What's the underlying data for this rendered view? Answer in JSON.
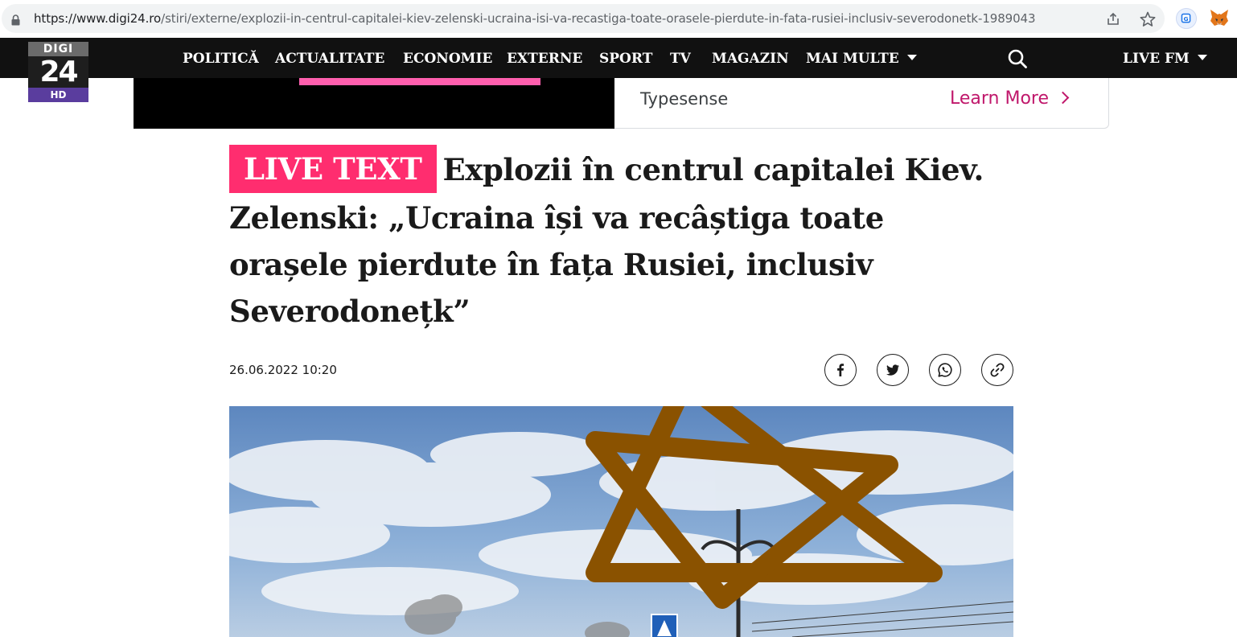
{
  "browser": {
    "url_host": "https://www.digi24.ro",
    "url_path": "/stiri/externe/explozii-in-centrul-capitalei-kiev-zelenski-ucraina-isi-va-recastiga-toate-orasele-pierdute-in-fata-rusiei-inclusiv-severodonetk-1989043"
  },
  "logo": {
    "top": "DIGI",
    "number": "24",
    "bottom": "HD"
  },
  "nav": {
    "items": [
      "POLITICĂ",
      "ACTUALITATE",
      "ECONOMIE",
      "EXTERNE",
      "SPORT",
      "TV",
      "MAGAZIN",
      "MAI MULTE"
    ],
    "live_fm": "LIVE FM"
  },
  "ad": {
    "brand": "Typesense",
    "cta": "Learn More"
  },
  "article": {
    "badge": "LIVE TEXT",
    "title": "Explozii în centrul capitalei Kiev. Zelenski: „Ucraina își va recâștiga toate orașele pierdute în fața Rusiei, inclusiv Severodonețk”",
    "date": "26.06.2022 10:20"
  },
  "share": [
    "facebook",
    "twitter",
    "whatsapp",
    "copy-link"
  ],
  "colors": {
    "accent": "#ff2d6f",
    "nav_bg": "#111111",
    "cta": "#c0176b",
    "overlay_star": "#8a5200"
  }
}
